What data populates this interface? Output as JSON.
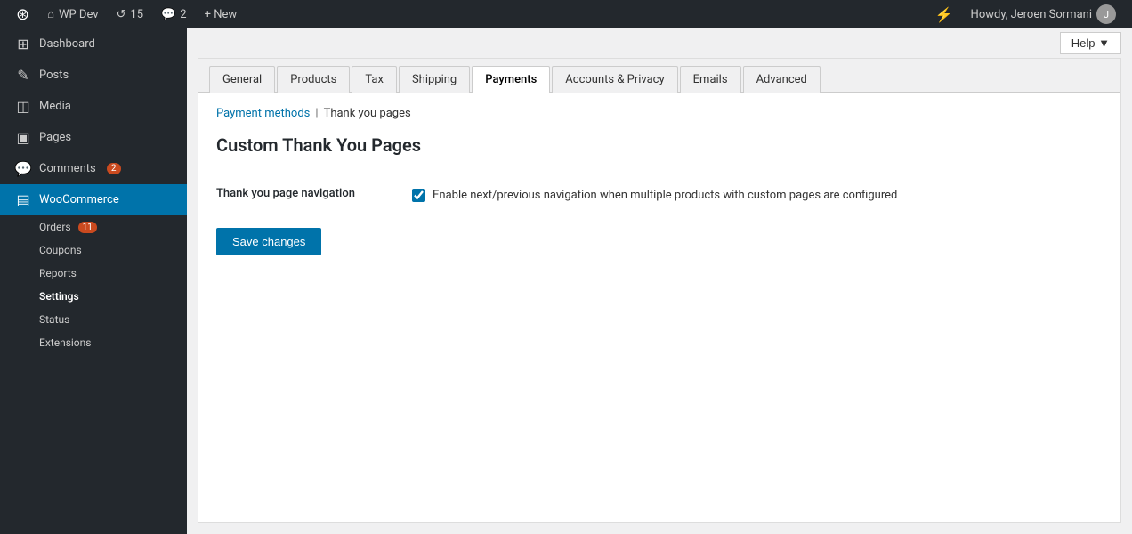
{
  "adminbar": {
    "logo": "W",
    "site_name": "WP Dev",
    "updates_count": "15",
    "comments_count": "2",
    "new_label": "+ New",
    "lightning_icon": "⚡",
    "howdy": "Howdy, Jeroen Sormani",
    "help_label": "Help ▼"
  },
  "sidebar": {
    "items": [
      {
        "id": "dashboard",
        "icon": "⊞",
        "label": "Dashboard",
        "active": false
      },
      {
        "id": "posts",
        "icon": "✏",
        "label": "Posts",
        "active": false
      },
      {
        "id": "media",
        "icon": "◫",
        "label": "Media",
        "active": false
      },
      {
        "id": "pages",
        "icon": "▣",
        "label": "Pages",
        "active": false
      },
      {
        "id": "comments",
        "icon": "💬",
        "label": "Comments",
        "badge": "2",
        "active": false
      },
      {
        "id": "woocommerce",
        "icon": "▤",
        "label": "WooCommerce",
        "active": true
      }
    ],
    "submenu": [
      {
        "id": "orders",
        "label": "Orders",
        "badge": "11",
        "active": false
      },
      {
        "id": "coupons",
        "label": "Coupons",
        "active": false
      },
      {
        "id": "reports",
        "label": "Reports",
        "active": false
      },
      {
        "id": "settings",
        "label": "Settings",
        "active": true
      },
      {
        "id": "status",
        "label": "Status",
        "active": false
      },
      {
        "id": "extensions",
        "label": "Extensions",
        "active": false
      }
    ]
  },
  "tabs": [
    {
      "id": "general",
      "label": "General",
      "active": false
    },
    {
      "id": "products",
      "label": "Products",
      "active": false
    },
    {
      "id": "tax",
      "label": "Tax",
      "active": false
    },
    {
      "id": "shipping",
      "label": "Shipping",
      "active": false
    },
    {
      "id": "payments",
      "label": "Payments",
      "active": true
    },
    {
      "id": "accounts",
      "label": "Accounts & Privacy",
      "active": false
    },
    {
      "id": "emails",
      "label": "Emails",
      "active": false
    },
    {
      "id": "advanced",
      "label": "Advanced",
      "active": false
    }
  ],
  "breadcrumb": {
    "link_label": "Payment methods",
    "separator": "|",
    "current": "Thank you pages"
  },
  "page": {
    "title": "Custom Thank You Pages",
    "setting_label": "Thank you page navigation",
    "checkbox_checked": true,
    "checkbox_description": "Enable next/previous navigation when multiple products with custom pages are configured",
    "save_label": "Save changes"
  }
}
